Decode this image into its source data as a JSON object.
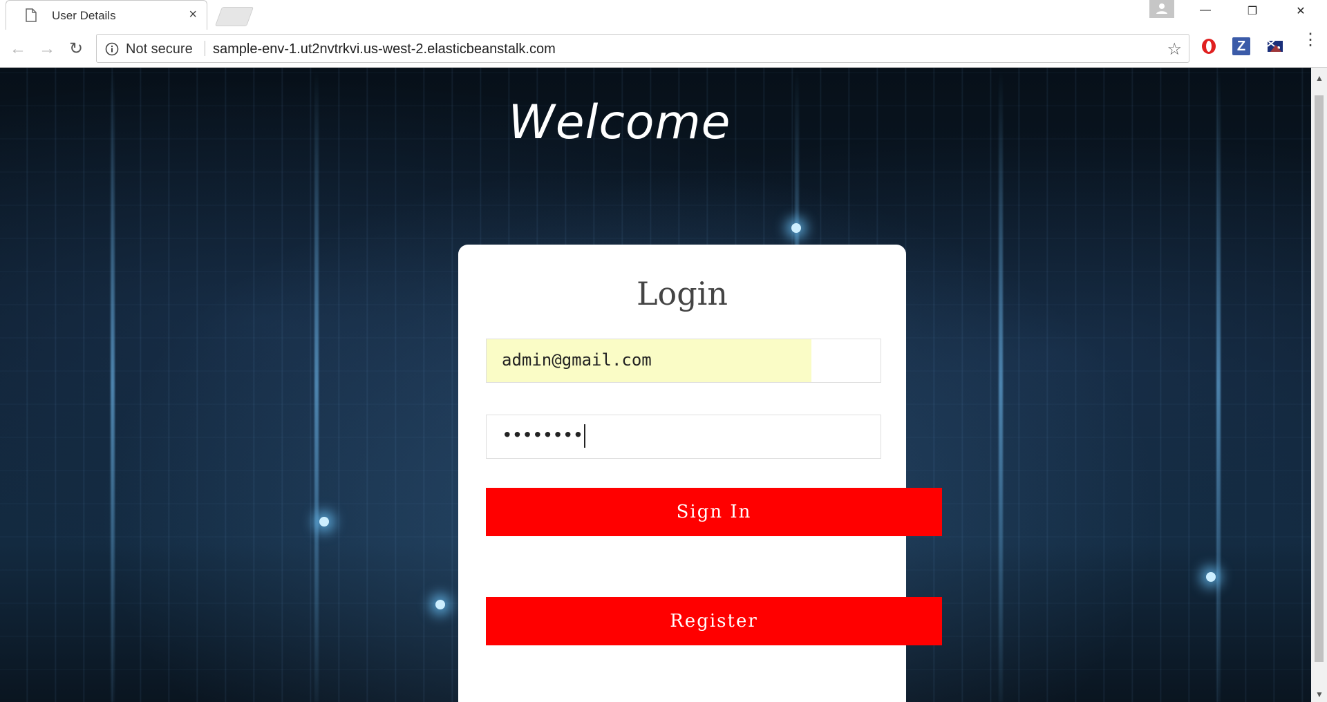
{
  "browser": {
    "tab_title": "User Details",
    "tab_close": "×",
    "security_label": "Not secure",
    "url": "sample-env-1.ut2nvtrkvi.us-west-2.elasticbeanstalk.com",
    "window_minimize": "—",
    "window_restore": "❐",
    "window_close": "✕",
    "ext_z_label": "Z"
  },
  "page": {
    "welcome": "Welcome",
    "login": {
      "title": "Login",
      "email_value": "admin@gmail.com",
      "password_value": "••••••••",
      "sign_in_label": "Sign In",
      "register_label": "Register"
    }
  },
  "colors": {
    "button_red": "#ff0000",
    "autofill_yellow": "#fafcc6"
  }
}
